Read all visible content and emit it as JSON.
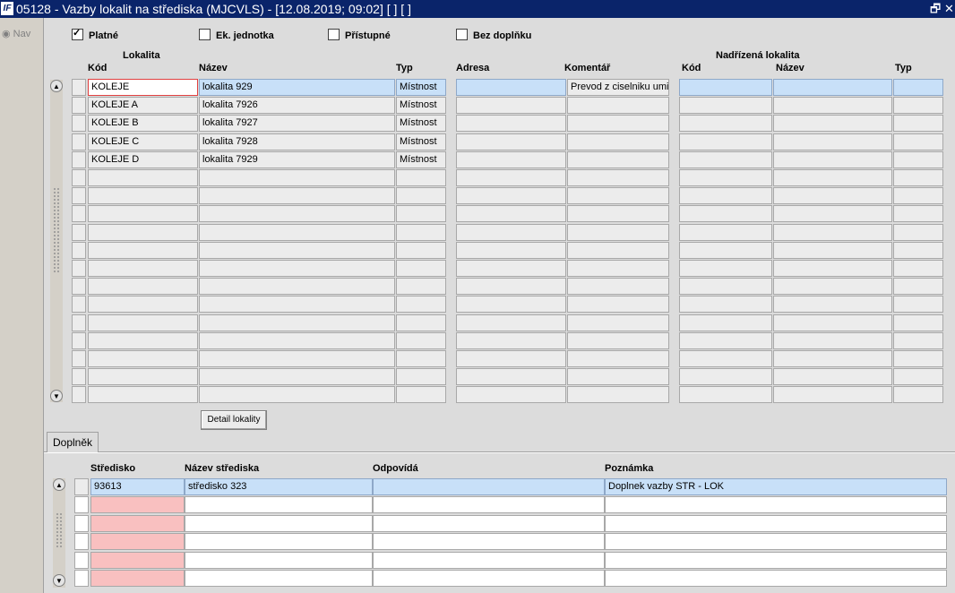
{
  "window": {
    "title": "05128 - Vazby lokalit na střediska (MJCVLS) - [12.08.2019; 09:02]  [ ]  [ ]",
    "logo": "IF",
    "restore_glyph": "🗗",
    "close_glyph": "✕"
  },
  "nav": {
    "label": "Nav"
  },
  "filters": [
    {
      "label": "Platné",
      "checked": true
    },
    {
      "label": "Ek. jednotka",
      "checked": false
    },
    {
      "label": "Přístupné",
      "checked": false
    },
    {
      "label": "Bez doplňku",
      "checked": false
    }
  ],
  "top_grid": {
    "group_lokalita": "Lokalita",
    "group_nadrizena": "Nadřízená lokalita",
    "columns": [
      "Kód",
      "Název",
      "Typ",
      "Adresa",
      "Komentář",
      "Kód",
      "Název",
      "Typ"
    ],
    "rows": [
      [
        "KOLEJE",
        "lokalita 929",
        "Místnost",
        "",
        "Prevod z ciselniku umis",
        "",
        "",
        ""
      ],
      [
        "KOLEJE A",
        "lokalita 7926",
        "Místnost",
        "",
        "",
        "",
        "",
        ""
      ],
      [
        "KOLEJE B",
        "lokalita 7927",
        "Místnost",
        "",
        "",
        "",
        "",
        ""
      ],
      [
        "KOLEJE C",
        "lokalita 7928",
        "Místnost",
        "",
        "",
        "",
        "",
        ""
      ],
      [
        "KOLEJE D",
        "lokalita 7929",
        "Místnost",
        "",
        "",
        "",
        "",
        ""
      ],
      [
        "",
        "",
        "",
        "",
        "",
        "",
        "",
        ""
      ],
      [
        "",
        "",
        "",
        "",
        "",
        "",
        "",
        ""
      ],
      [
        "",
        "",
        "",
        "",
        "",
        "",
        "",
        ""
      ],
      [
        "",
        "",
        "",
        "",
        "",
        "",
        "",
        ""
      ],
      [
        "",
        "",
        "",
        "",
        "",
        "",
        "",
        ""
      ],
      [
        "",
        "",
        "",
        "",
        "",
        "",
        "",
        ""
      ],
      [
        "",
        "",
        "",
        "",
        "",
        "",
        "",
        ""
      ],
      [
        "",
        "",
        "",
        "",
        "",
        "",
        "",
        ""
      ],
      [
        "",
        "",
        "",
        "",
        "",
        "",
        "",
        ""
      ],
      [
        "",
        "",
        "",
        "",
        "",
        "",
        "",
        ""
      ],
      [
        "",
        "",
        "",
        "",
        "",
        "",
        "",
        ""
      ],
      [
        "",
        "",
        "",
        "",
        "",
        "",
        "",
        ""
      ],
      [
        "",
        "",
        "",
        "",
        "",
        "",
        "",
        ""
      ]
    ]
  },
  "detail_button": "Detail lokality",
  "tab": {
    "label": "Doplněk"
  },
  "bottom_grid": {
    "columns": [
      "Středisko",
      "Název střediska",
      "Odpovídá",
      "Poznámka"
    ],
    "rows": [
      [
        "93613",
        "středisko 323",
        "",
        "Doplnek vazby STR - LOK"
      ],
      [
        "",
        "",
        "",
        ""
      ],
      [
        "",
        "",
        "",
        ""
      ],
      [
        "",
        "",
        "",
        ""
      ],
      [
        "",
        "",
        "",
        ""
      ],
      [
        "",
        "",
        "",
        ""
      ]
    ]
  },
  "colors": {
    "selected_row": "#c8e0f8",
    "required_field": "#f9c0c0",
    "titlebar": "#0a246a"
  }
}
